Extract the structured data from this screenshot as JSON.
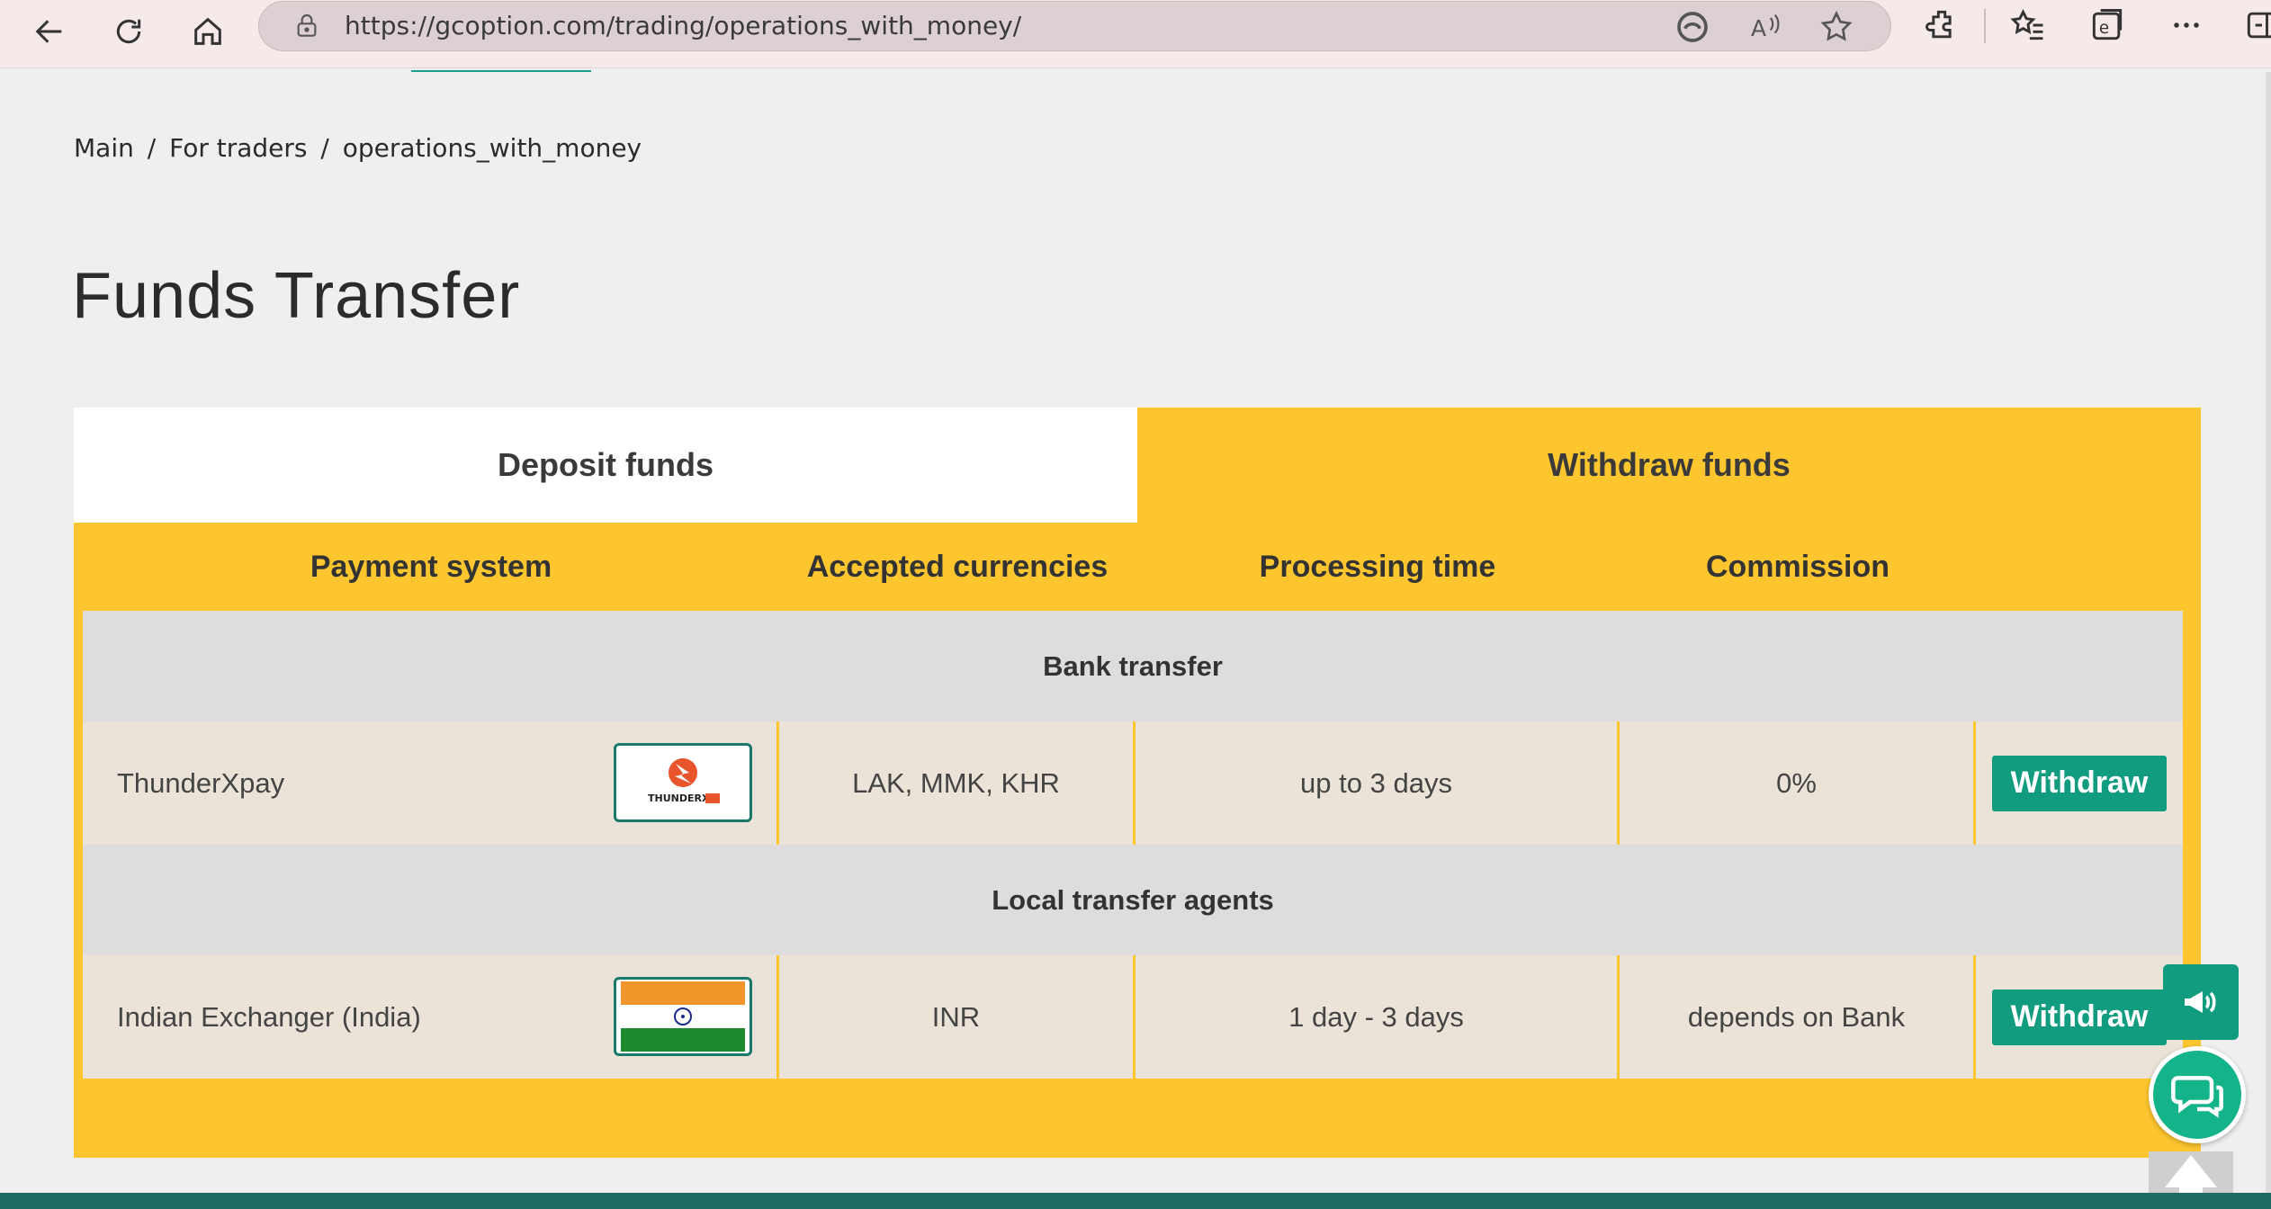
{
  "browser": {
    "url": "https://gcoption.com/trading/operations_with_money/",
    "icons": [
      "back-icon",
      "refresh-icon",
      "home-icon",
      "lock-icon",
      "edge-icon",
      "read-aloud-icon",
      "favorite-star-icon",
      "extensions-icon",
      "favorites-icon",
      "collections-icon",
      "more-icon",
      "sidebar-icon"
    ]
  },
  "breadcrumb": {
    "items": [
      "Main",
      "/",
      "For traders",
      "/",
      "operations_with_money"
    ]
  },
  "page": {
    "title": "Funds Transfer"
  },
  "tabs": {
    "deposit": "Deposit funds",
    "withdraw": "Withdraw funds"
  },
  "table": {
    "headers": [
      "Payment system",
      "Accepted currencies",
      "Processing time",
      "Commission"
    ],
    "groups": [
      {
        "title": "Bank transfer",
        "rows": [
          {
            "name": "ThunderXpay",
            "logo": "thunderxpay-logo",
            "currencies": "LAK, MMK, KHR",
            "time": "up to 3 days",
            "commission": "0%",
            "action": "Withdraw"
          }
        ]
      },
      {
        "title": "Local transfer agents",
        "rows": [
          {
            "name": "Indian Exchanger (India)",
            "logo": "india-flag",
            "currencies": "INR",
            "time": "1 day - 3 days",
            "commission": "depends on Bank",
            "action": "Withdraw"
          }
        ]
      }
    ]
  },
  "colors": {
    "accent_yellow": "#fdc62e",
    "button_green": "#119c7f",
    "chat_green": "#15b38a",
    "row_beige": "#ebe3d7",
    "group_gray": "#dedcdc"
  },
  "widgets": [
    "megaphone-icon",
    "chat-icon",
    "scroll-top-icon"
  ]
}
